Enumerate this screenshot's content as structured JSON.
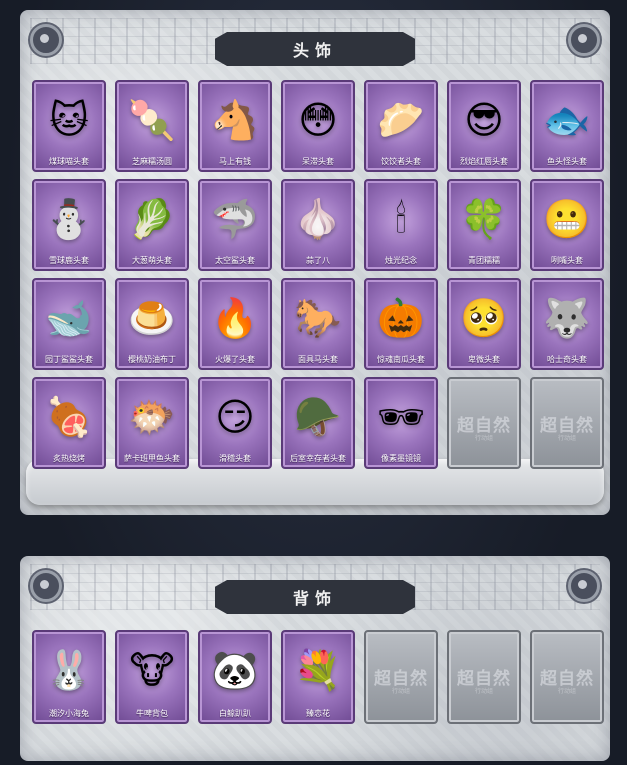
{
  "sections": [
    {
      "title": "头饰",
      "items": [
        {
          "label": "煤球喵头套",
          "icon": "🐱",
          "icon_name": "gray-cat-icon"
        },
        {
          "label": "芝麻糯汤圆",
          "icon": "🍡",
          "icon_name": "rice-ball-icon"
        },
        {
          "label": "马上有钱",
          "icon": "🐴",
          "icon_name": "pink-horse-icon"
        },
        {
          "label": "呆滞头套",
          "icon": "😳",
          "icon_name": "dazed-face-icon"
        },
        {
          "label": "饺饺者头套",
          "icon": "🥟",
          "icon_name": "dumpling-icon"
        },
        {
          "label": "烈焰红唇头套",
          "icon": "😎",
          "icon_name": "yellow-mouse-sunglasses-icon"
        },
        {
          "label": "鱼头怪头套",
          "icon": "🐟",
          "icon_name": "fish-head-icon"
        },
        {
          "label": "雪球鹿头套",
          "icon": "⛄",
          "icon_name": "snowman-deer-icon"
        },
        {
          "label": "大葱萌头套",
          "icon": "🥬",
          "icon_name": "scallion-icon"
        },
        {
          "label": "太空鲨头套",
          "icon": "🦈",
          "icon_name": "space-shark-icon"
        },
        {
          "label": "蒜了八",
          "icon": "🧄",
          "icon_name": "garlic-icon"
        },
        {
          "label": "烛光纪念",
          "icon": "🕯",
          "icon_name": "candle-icon"
        },
        {
          "label": "青团糯糯",
          "icon": "🍀",
          "icon_name": "green-dumpling-icon"
        },
        {
          "label": "咧嘴头套",
          "icon": "😬",
          "icon_name": "grinning-face-icon"
        },
        {
          "label": "园丁鲨鲨头套",
          "icon": "🐋",
          "icon_name": "gardener-shark-icon"
        },
        {
          "label": "樱桃奶油布丁",
          "icon": "🍮",
          "icon_name": "cherry-pudding-icon"
        },
        {
          "label": "火爆了头套",
          "icon": "🔥",
          "icon_name": "fireball-icon"
        },
        {
          "label": "面具马头套",
          "icon": "🐎",
          "icon_name": "horse-mask-icon"
        },
        {
          "label": "惊魂南瓜头套",
          "icon": "🎃",
          "icon_name": "pumpkin-icon"
        },
        {
          "label": "卑微头套",
          "icon": "🥺",
          "icon_name": "humble-face-icon"
        },
        {
          "label": "哈士奇头套",
          "icon": "🐺",
          "icon_name": "husky-sunglasses-icon"
        },
        {
          "label": "炙热烧烤",
          "icon": "🍖",
          "icon_name": "bbq-skewer-icon"
        },
        {
          "label": "萨卡班甲鱼头套",
          "icon": "🐡",
          "icon_name": "sacabambaspis-icon"
        },
        {
          "label": "滑稽头套",
          "icon": "😏",
          "icon_name": "smirk-face-icon"
        },
        {
          "label": "后室幸存者头套",
          "icon": "🪖",
          "icon_name": "gas-mask-helmet-icon"
        },
        {
          "label": "像素墨镜镜",
          "icon": "🕶",
          "icon_name": "pixel-sunglasses-icon"
        },
        {
          "label": "",
          "icon": "",
          "empty": true
        },
        {
          "label": "",
          "icon": "",
          "empty": true
        }
      ]
    },
    {
      "title": "背饰",
      "items": [
        {
          "label": "潮汐小海兔",
          "icon": "🐰",
          "icon_name": "blue-sea-rabbit-icon"
        },
        {
          "label": "牛啤背包",
          "icon": "🐮",
          "icon_name": "cow-beer-backpack-icon"
        },
        {
          "label": "白鲸趴趴",
          "icon": "🐼",
          "icon_name": "panda-plush-icon"
        },
        {
          "label": "臻恋花",
          "icon": "💐",
          "icon_name": "flower-ornament-icon"
        },
        {
          "label": "",
          "icon": "",
          "empty": true
        },
        {
          "label": "",
          "icon": "",
          "empty": true
        },
        {
          "label": "",
          "icon": "",
          "empty": true
        }
      ]
    }
  ],
  "empty_slot": {
    "mark": "超自然",
    "submark": "行动组"
  }
}
